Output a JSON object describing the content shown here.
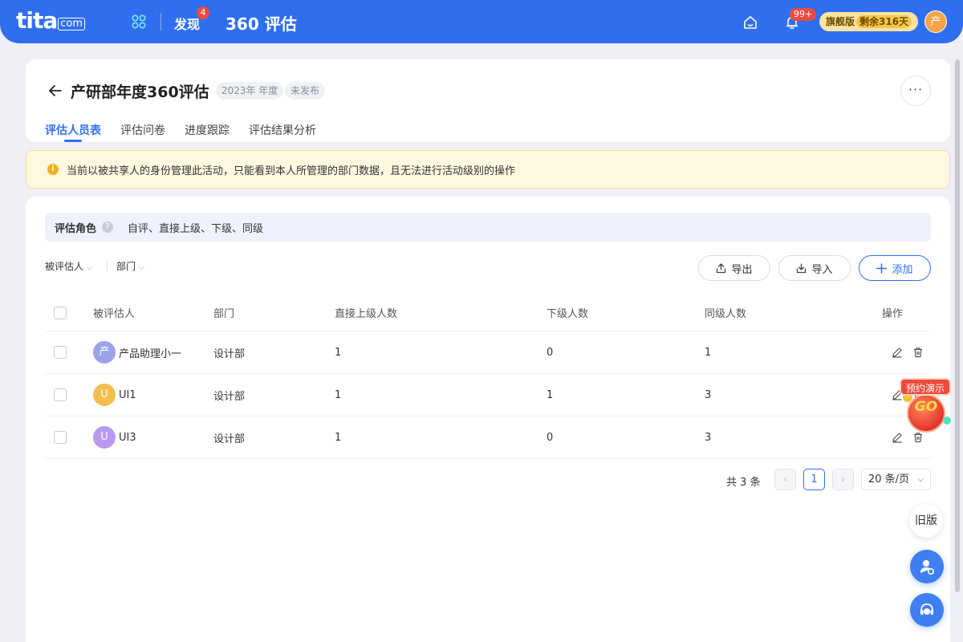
{
  "topbar": {
    "logo": "tita",
    "logo_suffix": "com",
    "discover_label": "发现",
    "discover_badge": "4",
    "module_title": "360 评估",
    "bell_badge": "99+",
    "version_label": "旗舰版",
    "version_remaining": "剩余316天",
    "avatar_text": "产"
  },
  "header": {
    "title": "产研部年度360评估",
    "tag_year": "2023年 年度",
    "tag_status": "未发布",
    "more_label": "···",
    "tabs": [
      {
        "label": "评估人员表"
      },
      {
        "label": "评估问卷"
      },
      {
        "label": "进度跟踪"
      },
      {
        "label": "评估结果分析"
      }
    ]
  },
  "notice": {
    "icon_text": "i",
    "text": "当前以被共享人的身份管理此活动，只能看到本人所管理的部门数据，且无法进行活动级别的操作"
  },
  "roles": {
    "label": "评估角色",
    "help": "?",
    "value": "自评、直接上级、下级、同级"
  },
  "filters": {
    "evaluatee": "被评估人",
    "department": "部门"
  },
  "actions": {
    "export": "导出",
    "import": "导入",
    "add": "添加"
  },
  "table": {
    "headers": {
      "evaluatee": "被评估人",
      "department": "部门",
      "direct_boss_count": "直接上级人数",
      "subordinate_count": "下级人数",
      "peer_count": "同级人数",
      "actions": "操作"
    },
    "rows": [
      {
        "avatar": "产",
        "avatar_color": "#9aa3e8",
        "name": "产品助理小一",
        "department": "设计部",
        "boss": "1",
        "sub": "0",
        "peer": "1"
      },
      {
        "avatar": "U",
        "avatar_color": "#f0bf4f",
        "name": "UI1",
        "department": "设计部",
        "boss": "1",
        "sub": "1",
        "peer": "3"
      },
      {
        "avatar": "U",
        "avatar_color": "#b99af0",
        "name": "UI3",
        "department": "设计部",
        "boss": "1",
        "sub": "0",
        "peer": "3"
      }
    ]
  },
  "pagination": {
    "total": "共 3 条",
    "current_page": "1",
    "page_size": "20 条/页"
  },
  "floating": {
    "demo_label": "预约演示",
    "go_text": "GO",
    "old_version": "旧版"
  },
  "colors": {
    "primary": "#2f6fef",
    "badge_red": "#f04a3f",
    "notice_bg": "#fff8e1"
  }
}
